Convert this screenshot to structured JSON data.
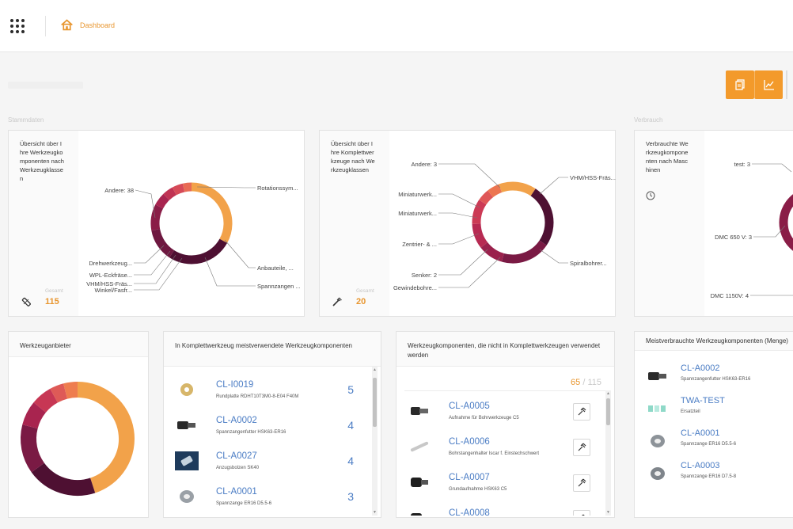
{
  "header": {
    "breadcrumb": "Dashboard"
  },
  "toolbar": {
    "documents_icon": "documents-icon",
    "chart_icon": "line-chart-icon"
  },
  "sections": {
    "stammdaten": "Stammdaten",
    "verbrauch": "Verbrauch"
  },
  "cards": {
    "components_by_class": {
      "title": "Übersicht über Ihre Werkzeugkomponenten nach Werkzeugklassen",
      "total_label": "Gesamt",
      "total_value": "115",
      "labels": [
        "Andere: 38",
        "Rotationssym...",
        "Anbauteile, ...",
        "Spannzangen ...",
        "Drehwerkzeug...",
        "WPL-Eckfräse...",
        "VHM/HSS-Fräs...",
        "Winkel/Fasfr..."
      ],
      "segments": [
        {
          "label": "Andere",
          "value": 38,
          "color": "#f2a24a"
        },
        {
          "label": "Rotationssym...",
          "value": 30,
          "color": "#4e1032"
        },
        {
          "label": "Anbauteile, ...",
          "value": 15,
          "color": "#6e1840"
        },
        {
          "label": "Spannzangen ...",
          "value": 12,
          "color": "#8a1d47"
        },
        {
          "label": "Winkel/Fasfr...",
          "value": 6,
          "color": "#a8244f"
        },
        {
          "label": "VHM/HSS-Fräs...",
          "value": 5,
          "color": "#c03353"
        },
        {
          "label": "WPL-Eckfräse...",
          "value": 5,
          "color": "#d64a58"
        },
        {
          "label": "Drehwerkzeug...",
          "value": 4,
          "color": "#e86b55"
        }
      ]
    },
    "complete_tools_by_class": {
      "title": "Übersicht über Ihre Komplettwerkzeuge nach Werkzeugklassen",
      "total_label": "Gesamt",
      "total_value": "20",
      "labels": [
        "Andere: 3",
        "Miniaturwerk...",
        "Miniaturwerk...",
        "Zentrier- & ...",
        "Senker: 2",
        "Gewindebohre...",
        "VHM/HSS-Fräs...",
        "Spiralbohrer..."
      ],
      "segments": [
        {
          "label": "Andere",
          "value": 3,
          "color": "#f2a24a"
        },
        {
          "label": "VHM/HSS-Fräs...",
          "value": 5,
          "color": "#4e1032"
        },
        {
          "label": "Spiralbohrer...",
          "value": 4,
          "color": "#7a1a44"
        },
        {
          "label": "Gewindebohre...",
          "value": 2,
          "color": "#9a214c"
        },
        {
          "label": "Senker",
          "value": 2,
          "color": "#b72a52"
        },
        {
          "label": "Zentrier- & ...",
          "value": 2,
          "color": "#cc3a55"
        },
        {
          "label": "Miniaturwerk...",
          "value": 1,
          "color": "#df5757"
        },
        {
          "label": "Miniaturwerk...",
          "value": 1,
          "color": "#ec7550"
        }
      ]
    },
    "components_by_machine": {
      "title": "Verbrauchte Werkzeugkomponenten nach Maschinen",
      "labels": [
        "test: 3",
        "DMC 650 V: 3",
        "DMC 1150V: 4"
      ]
    },
    "suppliers": {
      "title": "Werkzeuganbieter",
      "segments": [
        {
          "value": 45,
          "color": "#f2a24a"
        },
        {
          "value": 20,
          "color": "#4e1032"
        },
        {
          "value": 14,
          "color": "#7a1a44"
        },
        {
          "value": 7,
          "color": "#a8244f"
        },
        {
          "value": 6,
          "color": "#c73754"
        },
        {
          "value": 4,
          "color": "#de5a57"
        },
        {
          "value": 4,
          "color": "#ee7d4f"
        }
      ]
    },
    "most_used_in_complete": {
      "title": "In Komplettwerkzeug meistverwendete Werkzeugkomponenten",
      "items": [
        {
          "code": "CL-I0019",
          "desc": "Rundplatte RDHT10T3M0-8-E04 F40M",
          "count": "5"
        },
        {
          "code": "CL-A0002",
          "desc": "Spannzangenfutter HSK63-ER16",
          "count": "4"
        },
        {
          "code": "CL-A0027",
          "desc": "Anzugsbolzen SK40",
          "count": "4"
        },
        {
          "code": "CL-A0001",
          "desc": "Spannzange ER16 D5.5-6",
          "count": "3"
        }
      ]
    },
    "unused_components": {
      "title": "Werkzeugkomponenten, die nicht in Komplettwerkzeugen verwendet werden",
      "ratio_a": "65",
      "ratio_b": " / 115",
      "items": [
        {
          "code": "CL-A0005",
          "desc": "Aufnahme für Bohrwerkzeuge C5"
        },
        {
          "code": "CL-A0006",
          "desc": "Bohrstangenhalter Iscar f. Einstechschwert"
        },
        {
          "code": "CL-A0007",
          "desc": "Grundaufnahme HSK63 C5"
        },
        {
          "code": "CL-A0008",
          "desc": ""
        }
      ]
    },
    "most_consumed": {
      "title": "Meistverbrauchte Werkzeugkomponenten (Menge)",
      "items": [
        {
          "code": "CL-A0002",
          "desc": "Spannzangenfutter HSK63-ER16"
        },
        {
          "code": "TWA-TEST",
          "desc": "Ersatzteil"
        },
        {
          "code": "CL-A0001",
          "desc": "Spannzange ER16 D5.5-6"
        },
        {
          "code": "CL-A0003",
          "desc": "Spannzange ER16 D7.5-8"
        }
      ]
    }
  }
}
